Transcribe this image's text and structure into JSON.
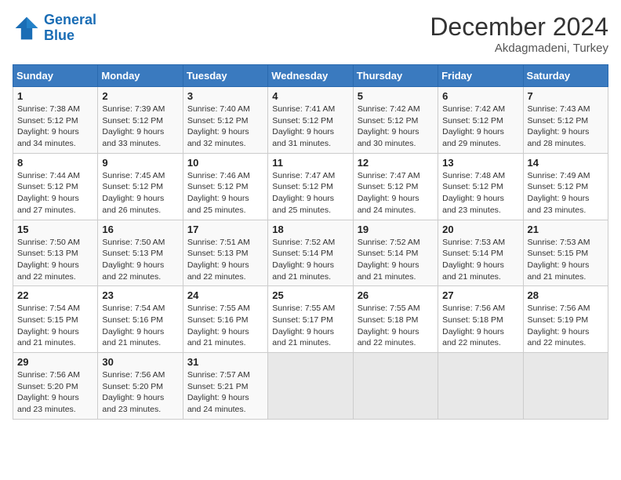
{
  "header": {
    "logo_line1": "General",
    "logo_line2": "Blue",
    "title": "December 2024",
    "subtitle": "Akdagmadeni, Turkey"
  },
  "calendar": {
    "weekdays": [
      "Sunday",
      "Monday",
      "Tuesday",
      "Wednesday",
      "Thursday",
      "Friday",
      "Saturday"
    ],
    "weeks": [
      [
        {
          "day": "1",
          "sunrise": "7:38 AM",
          "sunset": "5:12 PM",
          "daylight": "9 hours and 34 minutes."
        },
        {
          "day": "2",
          "sunrise": "7:39 AM",
          "sunset": "5:12 PM",
          "daylight": "9 hours and 33 minutes."
        },
        {
          "day": "3",
          "sunrise": "7:40 AM",
          "sunset": "5:12 PM",
          "daylight": "9 hours and 32 minutes."
        },
        {
          "day": "4",
          "sunrise": "7:41 AM",
          "sunset": "5:12 PM",
          "daylight": "9 hours and 31 minutes."
        },
        {
          "day": "5",
          "sunrise": "7:42 AM",
          "sunset": "5:12 PM",
          "daylight": "9 hours and 30 minutes."
        },
        {
          "day": "6",
          "sunrise": "7:42 AM",
          "sunset": "5:12 PM",
          "daylight": "9 hours and 29 minutes."
        },
        {
          "day": "7",
          "sunrise": "7:43 AM",
          "sunset": "5:12 PM",
          "daylight": "9 hours and 28 minutes."
        }
      ],
      [
        {
          "day": "8",
          "sunrise": "7:44 AM",
          "sunset": "5:12 PM",
          "daylight": "9 hours and 27 minutes."
        },
        {
          "day": "9",
          "sunrise": "7:45 AM",
          "sunset": "5:12 PM",
          "daylight": "9 hours and 26 minutes."
        },
        {
          "day": "10",
          "sunrise": "7:46 AM",
          "sunset": "5:12 PM",
          "daylight": "9 hours and 25 minutes."
        },
        {
          "day": "11",
          "sunrise": "7:47 AM",
          "sunset": "5:12 PM",
          "daylight": "9 hours and 25 minutes."
        },
        {
          "day": "12",
          "sunrise": "7:47 AM",
          "sunset": "5:12 PM",
          "daylight": "9 hours and 24 minutes."
        },
        {
          "day": "13",
          "sunrise": "7:48 AM",
          "sunset": "5:12 PM",
          "daylight": "9 hours and 23 minutes."
        },
        {
          "day": "14",
          "sunrise": "7:49 AM",
          "sunset": "5:12 PM",
          "daylight": "9 hours and 23 minutes."
        }
      ],
      [
        {
          "day": "15",
          "sunrise": "7:50 AM",
          "sunset": "5:13 PM",
          "daylight": "9 hours and 22 minutes."
        },
        {
          "day": "16",
          "sunrise": "7:50 AM",
          "sunset": "5:13 PM",
          "daylight": "9 hours and 22 minutes."
        },
        {
          "day": "17",
          "sunrise": "7:51 AM",
          "sunset": "5:13 PM",
          "daylight": "9 hours and 22 minutes."
        },
        {
          "day": "18",
          "sunrise": "7:52 AM",
          "sunset": "5:14 PM",
          "daylight": "9 hours and 21 minutes."
        },
        {
          "day": "19",
          "sunrise": "7:52 AM",
          "sunset": "5:14 PM",
          "daylight": "9 hours and 21 minutes."
        },
        {
          "day": "20",
          "sunrise": "7:53 AM",
          "sunset": "5:14 PM",
          "daylight": "9 hours and 21 minutes."
        },
        {
          "day": "21",
          "sunrise": "7:53 AM",
          "sunset": "5:15 PM",
          "daylight": "9 hours and 21 minutes."
        }
      ],
      [
        {
          "day": "22",
          "sunrise": "7:54 AM",
          "sunset": "5:15 PM",
          "daylight": "9 hours and 21 minutes."
        },
        {
          "day": "23",
          "sunrise": "7:54 AM",
          "sunset": "5:16 PM",
          "daylight": "9 hours and 21 minutes."
        },
        {
          "day": "24",
          "sunrise": "7:55 AM",
          "sunset": "5:16 PM",
          "daylight": "9 hours and 21 minutes."
        },
        {
          "day": "25",
          "sunrise": "7:55 AM",
          "sunset": "5:17 PM",
          "daylight": "9 hours and 21 minutes."
        },
        {
          "day": "26",
          "sunrise": "7:55 AM",
          "sunset": "5:18 PM",
          "daylight": "9 hours and 22 minutes."
        },
        {
          "day": "27",
          "sunrise": "7:56 AM",
          "sunset": "5:18 PM",
          "daylight": "9 hours and 22 minutes."
        },
        {
          "day": "28",
          "sunrise": "7:56 AM",
          "sunset": "5:19 PM",
          "daylight": "9 hours and 22 minutes."
        }
      ],
      [
        {
          "day": "29",
          "sunrise": "7:56 AM",
          "sunset": "5:20 PM",
          "daylight": "9 hours and 23 minutes."
        },
        {
          "day": "30",
          "sunrise": "7:56 AM",
          "sunset": "5:20 PM",
          "daylight": "9 hours and 23 minutes."
        },
        {
          "day": "31",
          "sunrise": "7:57 AM",
          "sunset": "5:21 PM",
          "daylight": "9 hours and 24 minutes."
        },
        null,
        null,
        null,
        null
      ]
    ]
  }
}
